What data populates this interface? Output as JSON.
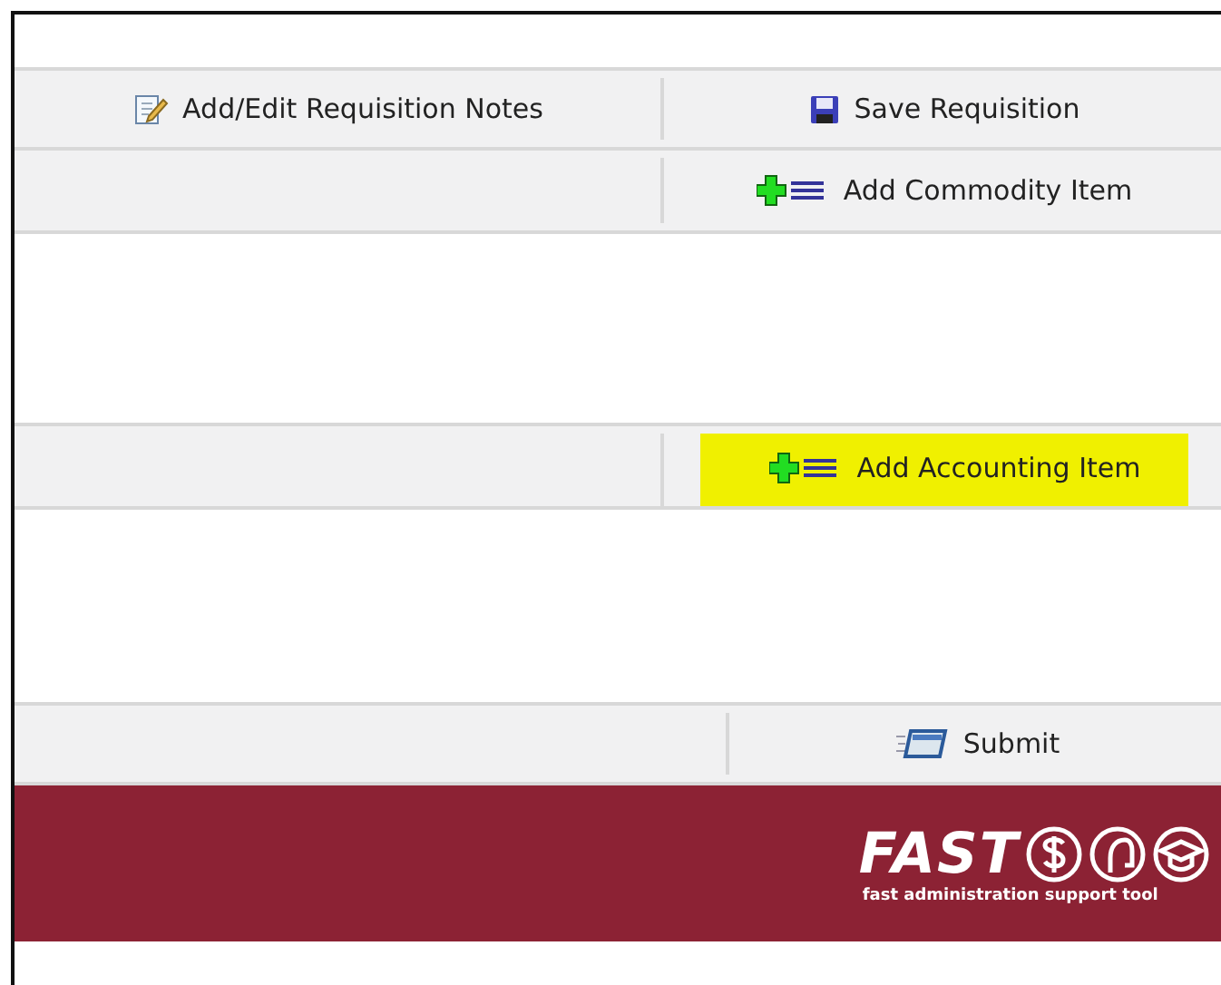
{
  "toolbar": [
    {
      "kind": "notes",
      "label": "Add/Edit Requisition Notes"
    },
    {
      "kind": "save",
      "label": "Save Requisition"
    }
  ],
  "commodity": {
    "label": "Add Commodity Item",
    "highlighted": false
  },
  "accounting": {
    "label": "Add Accounting Item",
    "highlighted": true
  },
  "submit": {
    "label": "Submit"
  },
  "footer": {
    "logo": "FAST",
    "tagline": "fast administration support tool"
  }
}
